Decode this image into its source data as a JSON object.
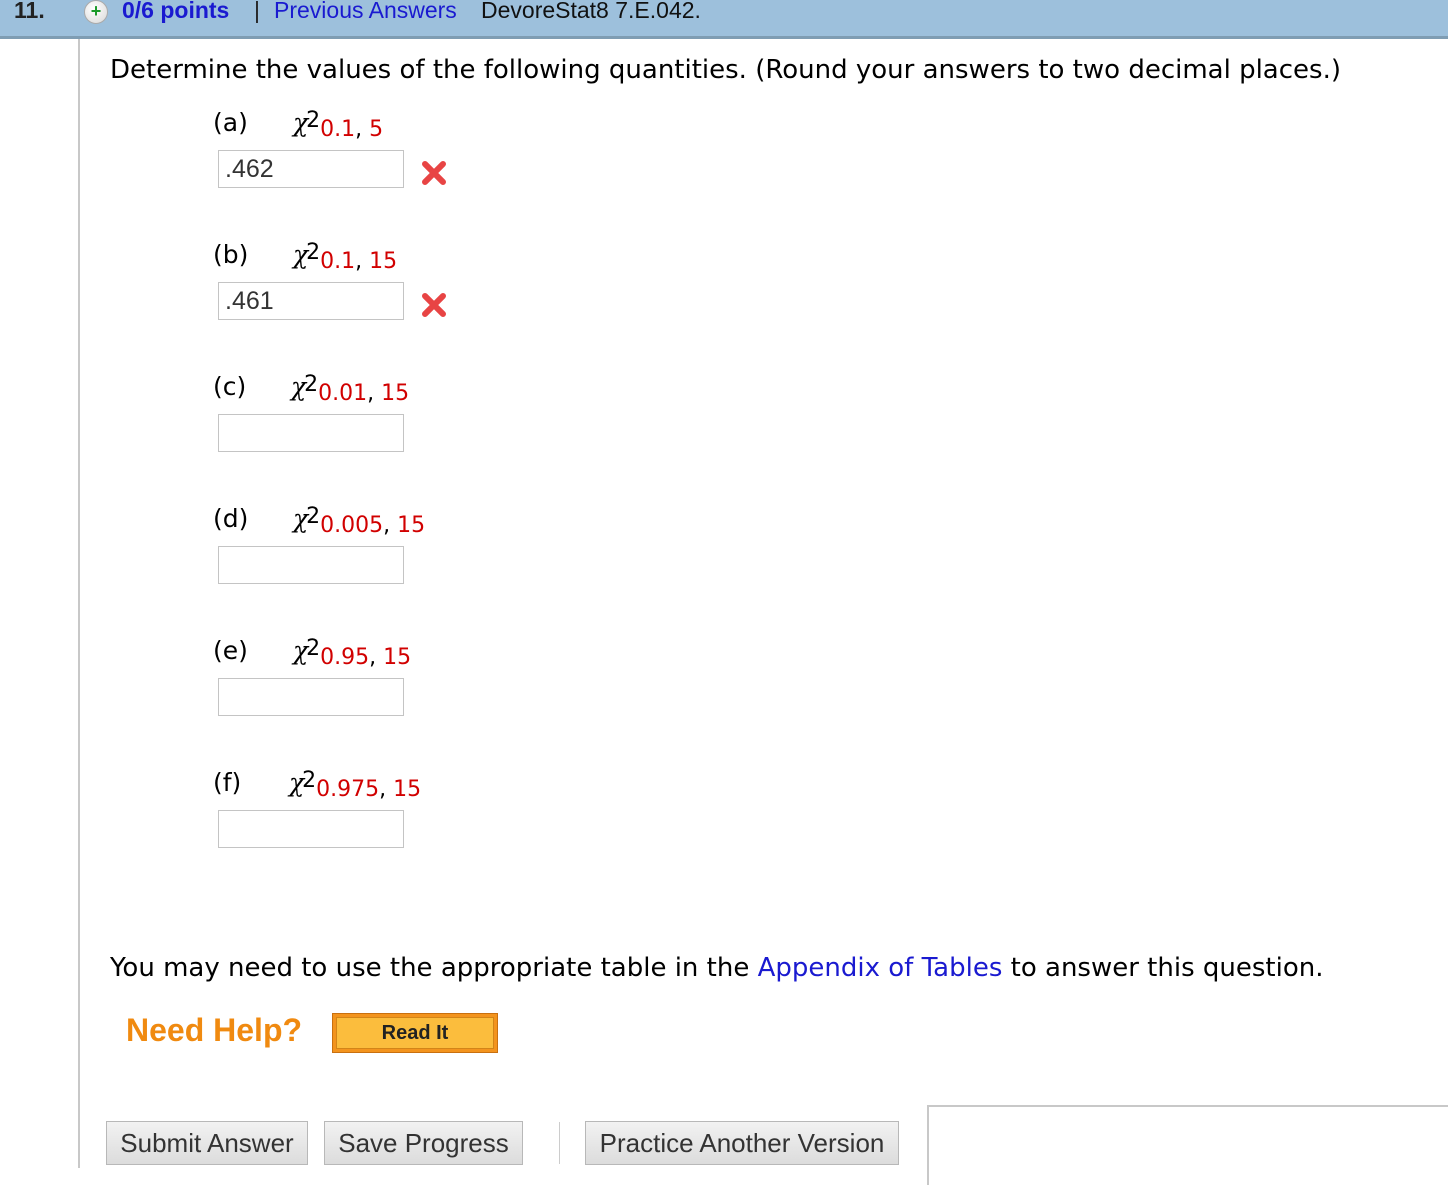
{
  "header": {
    "question_number": "11.",
    "points": "0/6 points",
    "separator": "|",
    "previous_answers": "Previous Answers",
    "problem_code": "DevoreStat8 7.E.042.",
    "plus_icon": "+"
  },
  "prompt": "Determine the values of the following quantities. (Round your answers to two decimal places.)",
  "parts": [
    {
      "label": "(a)",
      "symbol": "χ",
      "exp": "2",
      "alpha": "0.1",
      "comma": ",",
      "df": "5",
      "value": ".462",
      "status": "incorrect"
    },
    {
      "label": "(b)",
      "symbol": "χ",
      "exp": "2",
      "alpha": "0.1",
      "comma": ",",
      "df": "15",
      "value": ".461",
      "status": "incorrect"
    },
    {
      "label": "(c)",
      "symbol": "χ",
      "exp": "2",
      "alpha": "0.01",
      "comma": ",",
      "df": "15",
      "value": "",
      "status": ""
    },
    {
      "label": "(d)",
      "symbol": "χ",
      "exp": "2",
      "alpha": "0.005",
      "comma": ",",
      "df": "15",
      "value": "",
      "status": ""
    },
    {
      "label": "(e)",
      "symbol": "χ",
      "exp": "2",
      "alpha": "0.95",
      "comma": ",",
      "df": "15",
      "value": "",
      "status": ""
    },
    {
      "label": "(f)",
      "symbol": "χ",
      "exp": "2",
      "alpha": "0.975",
      "comma": ",",
      "df": "15",
      "value": "",
      "status": ""
    }
  ],
  "note": {
    "before": "You may need to use the appropriate table in the ",
    "link": "Appendix of Tables",
    "after": " to answer this question."
  },
  "help": {
    "label": "Need Help?",
    "read_it": "Read It"
  },
  "buttons": {
    "submit": "Submit Answer",
    "save": "Save Progress",
    "practice": "Practice Another Version"
  },
  "colors": {
    "header_bg": "#9dc0dc",
    "link": "#1a1ad0",
    "subscript": "#d10000",
    "help_orange": "#f08a10",
    "incorrect_red": "#e84444"
  }
}
